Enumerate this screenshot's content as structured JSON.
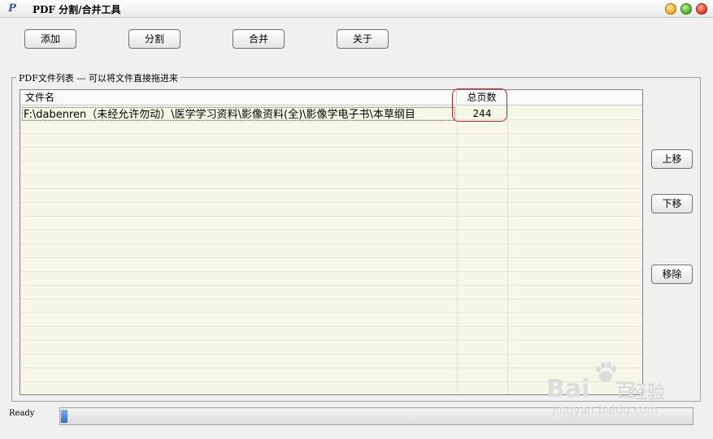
{
  "window": {
    "title": "PDF 分割/合并工具",
    "icon_glyph": "P"
  },
  "toolbar": {
    "add_label": "添加",
    "split_label": "分割",
    "merge_label": "合并",
    "about_label": "关于"
  },
  "file_group": {
    "label": "PDF文件列表  --- 可以将文件直接拖进来",
    "columns": [
      "文件名",
      "总页数"
    ],
    "rows": [
      {
        "file_name": "F:\\dabenren（未经允许勿动）\\医学学习资料\\影像资料(全)\\影像学电子书\\本草纲目",
        "page_count": "244"
      }
    ]
  },
  "side_buttons": {
    "up_label": "上移",
    "down_label": "下移",
    "remove_label": "移除"
  },
  "status": {
    "text": "Ready",
    "progress": 0.01
  },
  "watermark": {
    "logo_text": "Bai",
    "logo_suffix": "百",
    "name": "经验",
    "url": "jingyan.baidu.com"
  },
  "colors": {
    "highlight": "#d02020",
    "list_background": "#f7f7e8",
    "progress_fill": "#2f6ccc"
  }
}
